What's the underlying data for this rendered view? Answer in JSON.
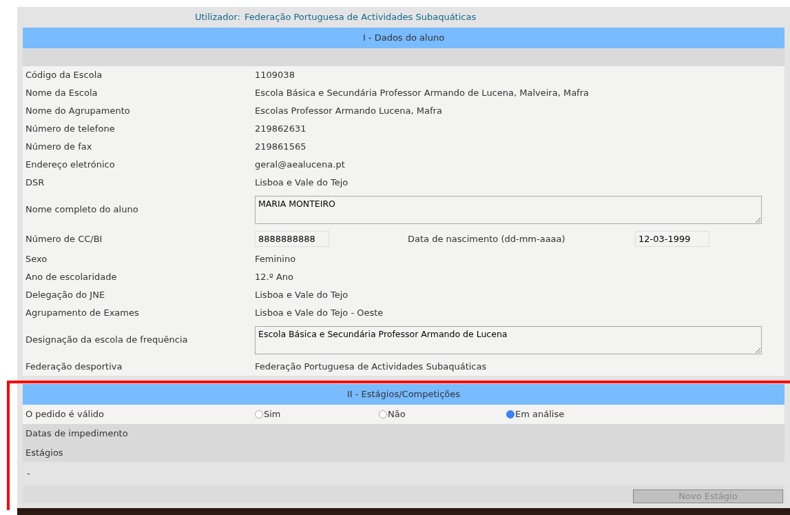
{
  "user_line": {
    "label": "Utilizador:",
    "value": "Federação Portuguesa de Actividades Subaquáticas"
  },
  "section_1": {
    "title": "I - Dados do aluno",
    "rows": [
      {
        "kind": "text",
        "label": "Código da Escola",
        "value": "1109038"
      },
      {
        "kind": "text",
        "label": "Nome da Escola",
        "value": "Escola Básica e Secundária Professor Armando de Lucena, Malveira, Mafra"
      },
      {
        "kind": "text",
        "label": "Nome do Agrupamento",
        "value": "Escolas Professor Armando Lucena, Mafra"
      },
      {
        "kind": "text",
        "label": "Número de telefone",
        "value": "219862631"
      },
      {
        "kind": "text",
        "label": "Número de fax",
        "value": "219861565"
      },
      {
        "kind": "text",
        "label": "Endereço eletrónico",
        "value": "geral@aealucena.pt"
      },
      {
        "kind": "text",
        "label": "DSR",
        "value": "Lisboa e Vale do Tejo"
      },
      {
        "kind": "textarea",
        "label": "Nome completo do aluno",
        "value": "MARIA MONTEIRO"
      },
      {
        "kind": "pair",
        "label": "Número de CC/BI",
        "value": "8888888888",
        "label_2": "Data de nascimento (dd-mm-aaaa)",
        "value_2": "12-03-1999"
      },
      {
        "kind": "text",
        "label": "Sexo",
        "value": "Feminino"
      },
      {
        "kind": "text",
        "label": "Ano de escolaridade",
        "value": "12.º Ano"
      },
      {
        "kind": "text",
        "label": "Delegação do JNE",
        "value": "Lisboa e Vale do Tejo"
      },
      {
        "kind": "text",
        "label": "Agrupamento de Exames",
        "value": "Lisboa e Vale do Tejo - Oeste"
      },
      {
        "kind": "textarea",
        "label": "Designação da escola de frequência",
        "value": "Escola Básica e Secundária Professor Armando de Lucena"
      },
      {
        "kind": "text",
        "label": "Federação desportiva",
        "value": "Federação Portuguesa de Actividades Subaquáticas"
      }
    ]
  },
  "section_2": {
    "title": "II - Estágios/Competições",
    "valid_label": "O pedido é válido",
    "valid_options": [
      {
        "label": "Sim",
        "selected": false
      },
      {
        "label": "Não",
        "selected": false
      },
      {
        "label": "Em análise",
        "selected": true
      }
    ],
    "impediment_label": "Datas de impedimento",
    "stages_label": "Estágios",
    "stages_empty": "-",
    "new_stage_button": "Novo Estágio"
  }
}
